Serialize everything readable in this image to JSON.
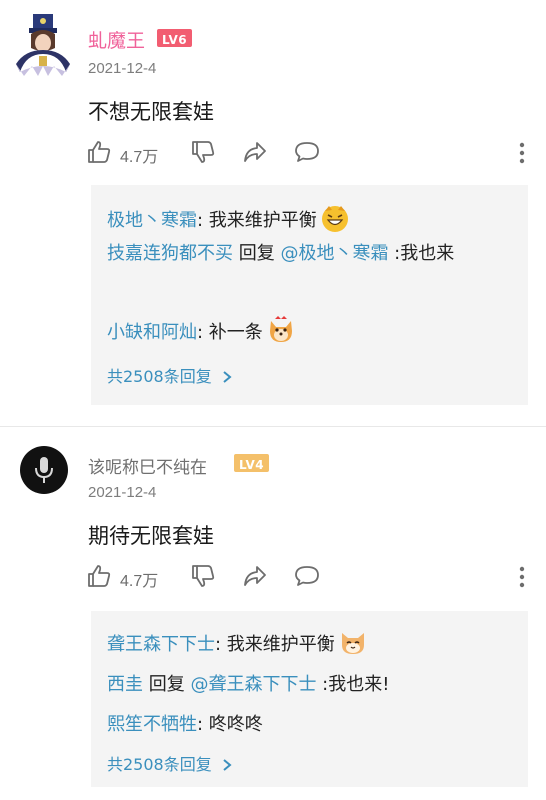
{
  "comments": [
    {
      "username": "虬魔王",
      "level": "LV6",
      "date": "2021-12-4",
      "text": "不想无限套娃",
      "likes": "4.7万",
      "replies": [
        {
          "user": "极地丶寒霜",
          "sep": ": ",
          "text": "我来维护平衡",
          "emoji": "grinning-tiger-emoji"
        },
        {
          "user": "技嘉连狗都不买",
          "mid": " 回复 ",
          "target": "@极地丶寒霜",
          "text": " :我也来"
        },
        {
          "user": "小缺和阿灿",
          "sep": ": ",
          "text": "补一条",
          "emoji": "shiba-dog-emoji"
        }
      ],
      "more_replies": "共2508条回复"
    },
    {
      "username": "该呢称巳不纯在",
      "level": "LV4",
      "date": "2021-12-4",
      "text": "期待无限套娃",
      "likes": "4.7万",
      "replies": [
        {
          "user": "聋王森下下士",
          "sep": ": ",
          "text": "我来维护平衡",
          "emoji": "cat-emoji"
        },
        {
          "user": "西圭",
          "mid": " 回复 ",
          "target": "@聋王森下下士",
          "text": " :我也来!"
        },
        {
          "user": "熙笙不牺牲",
          "sep": ": ",
          "text": "咚咚咚"
        }
      ],
      "more_replies": "共2508条回复"
    }
  ],
  "colors": {
    "username_pink": "#f0629a",
    "link_blue": "#3a8fbd",
    "lv6_badge": "#f25d71",
    "lv4_badge": "#f4c06a"
  }
}
